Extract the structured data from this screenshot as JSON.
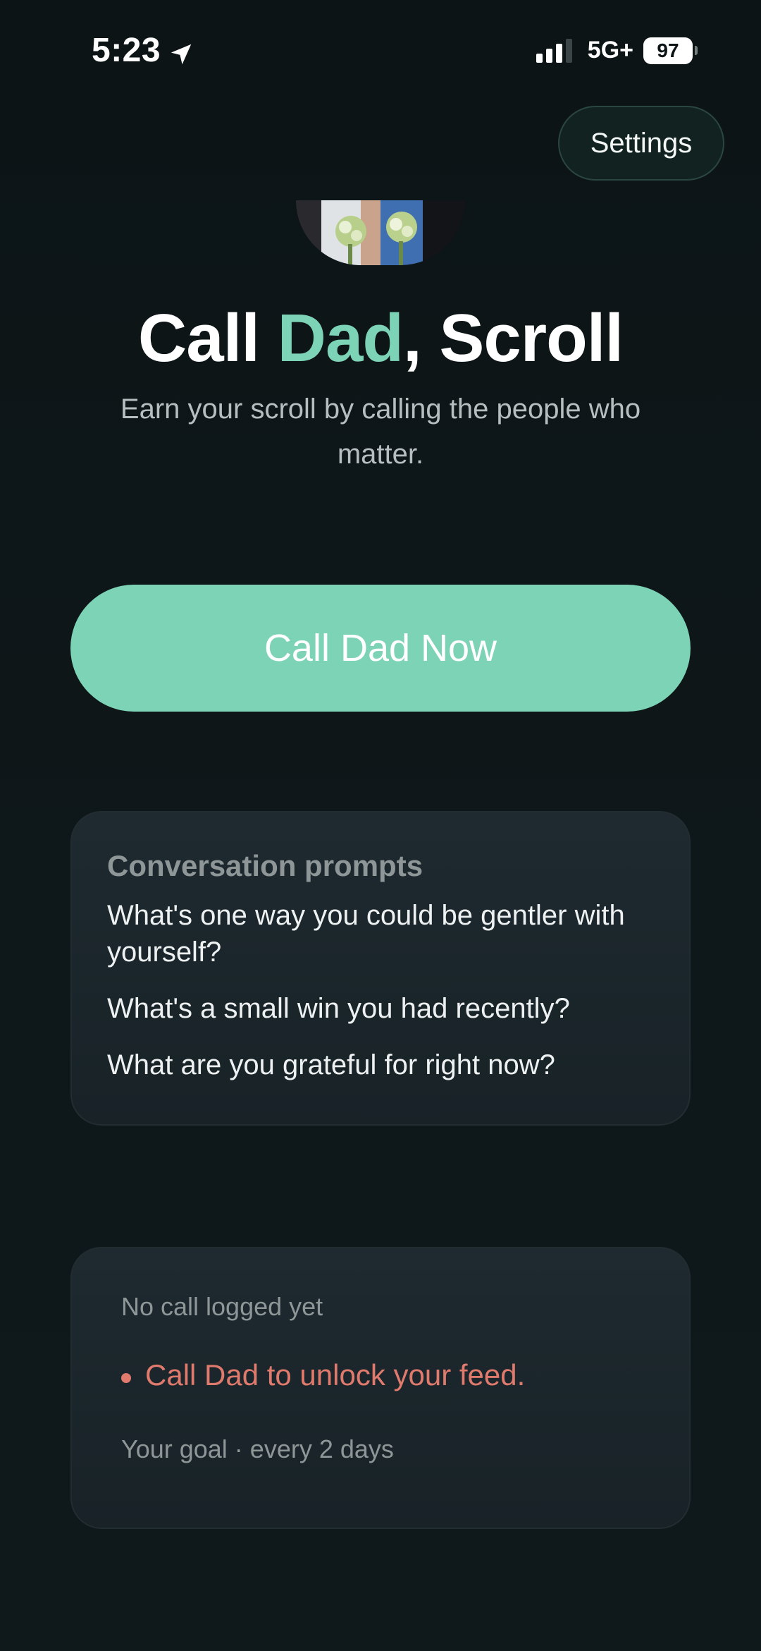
{
  "status_bar": {
    "time": "5:23",
    "network": "5G+",
    "battery": "97"
  },
  "header": {
    "settings_label": "Settings"
  },
  "hero": {
    "title_prefix": "Call ",
    "title_accent": "Dad",
    "title_suffix": ", Scroll",
    "subtitle": "Earn your scroll by calling the people who matter."
  },
  "call_button": {
    "label": "Call Dad Now"
  },
  "prompts": {
    "heading": "Conversation prompts",
    "items": [
      "What's one way you could be gentler with yourself?",
      "What's a small win you had recently?",
      "What are you grateful for right now?"
    ]
  },
  "status_card": {
    "no_call_text": "No call logged yet",
    "alert_text": "Call Dad to unlock your feed.",
    "goal_text": "Your goal · every 2 days"
  },
  "colors": {
    "accent": "#7dd3b5",
    "alert": "#df7a6c",
    "background": "#0c1416"
  }
}
